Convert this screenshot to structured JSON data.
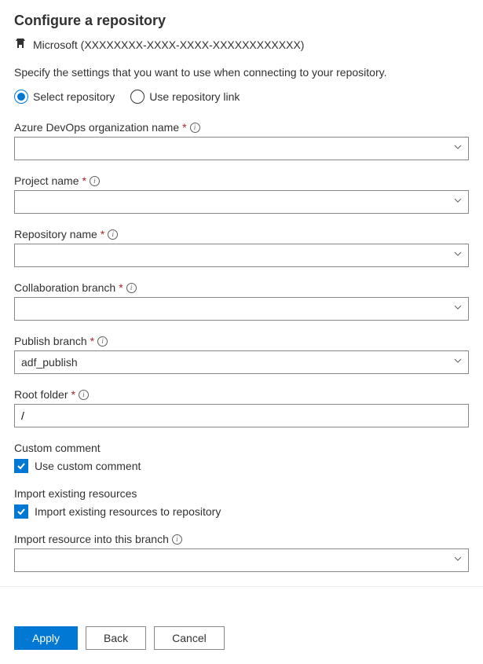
{
  "title": "Configure a repository",
  "tenant": "Microsoft (XXXXXXXX-XXXX-XXXX-XXXXXXXXXXXX)",
  "description": "Specify the settings that you want to use when connecting to your repository.",
  "radio": {
    "select_repo": "Select repository",
    "use_link": "Use repository link"
  },
  "fields": {
    "orgName": {
      "label": "Azure DevOps organization name",
      "value": ""
    },
    "projectName": {
      "label": "Project name",
      "value": ""
    },
    "repoName": {
      "label": "Repository name",
      "value": ""
    },
    "collabBranch": {
      "label": "Collaboration branch",
      "value": ""
    },
    "publishBranch": {
      "label": "Publish branch",
      "value": "adf_publish"
    },
    "rootFolder": {
      "label": "Root folder",
      "value": "/"
    }
  },
  "customComment": {
    "section": "Custom comment",
    "checkboxLabel": "Use custom comment"
  },
  "importExisting": {
    "section": "Import existing resources",
    "checkboxLabel": "Import existing resources to repository"
  },
  "importBranch": {
    "label": "Import resource into this branch",
    "value": ""
  },
  "buttons": {
    "apply": "Apply",
    "back": "Back",
    "cancel": "Cancel"
  }
}
